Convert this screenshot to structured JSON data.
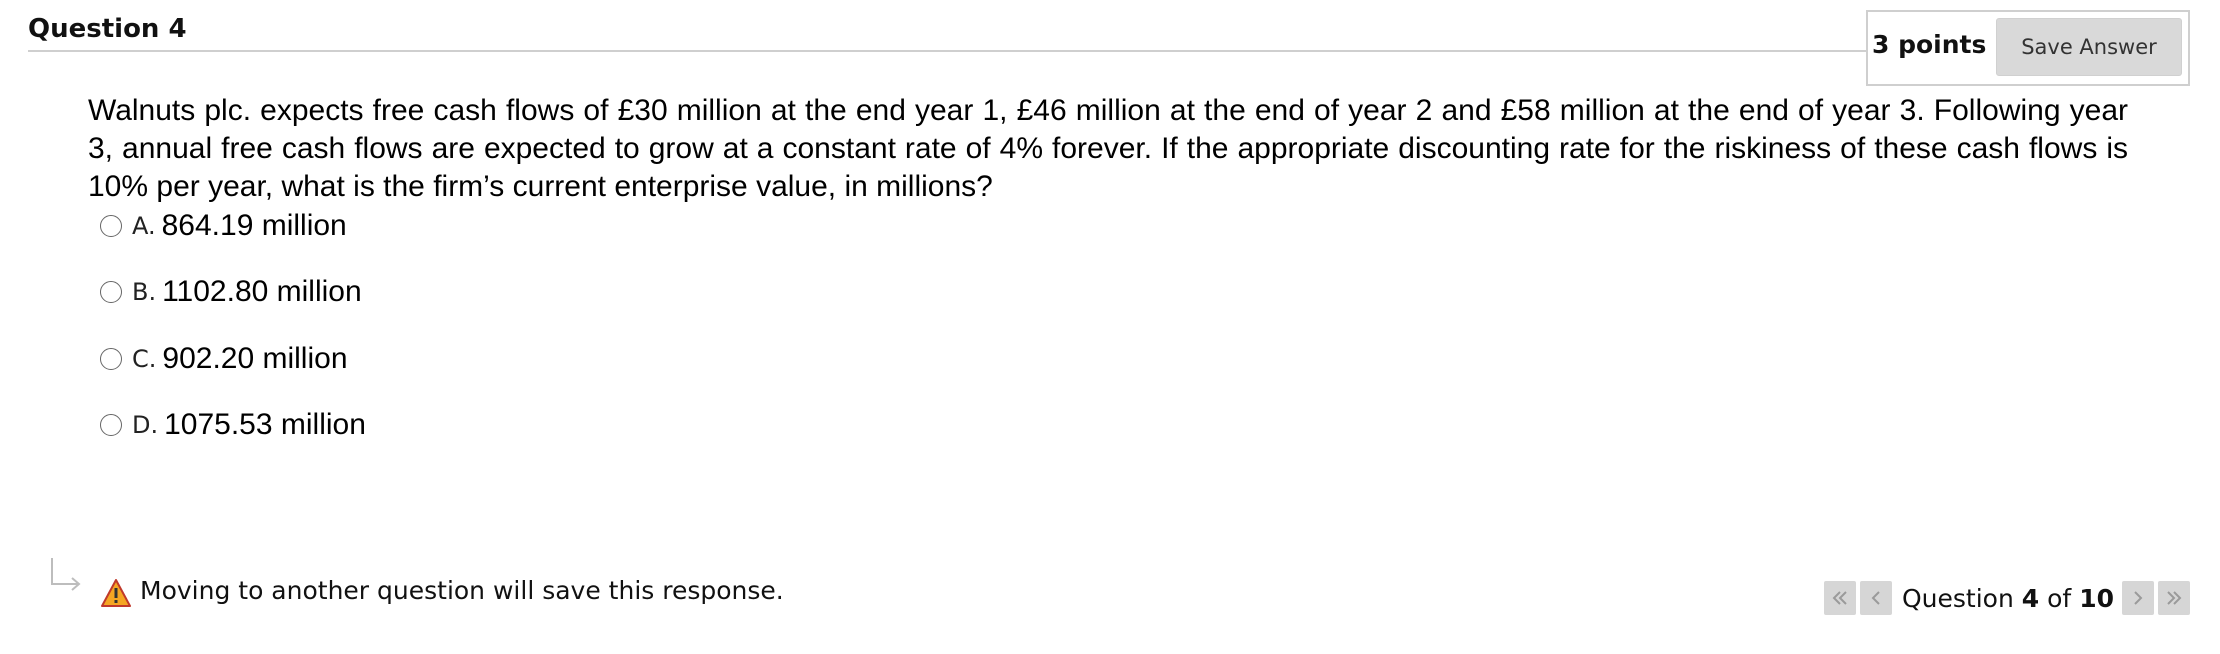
{
  "header": {
    "title": "Question 4",
    "points": "3 points",
    "save_label": "Save Answer"
  },
  "question": {
    "text": "Walnuts plc. expects free cash flows of £30 million at the end year 1, £46 million at the end of year 2 and £58 million at the end of year 3. Following year 3, annual free cash flows are expected to grow at a constant rate of 4% forever. If the appropriate discounting rate for the riskiness of these cash flows is 10% per year, what is the firm’s current enterprise value, in millions?"
  },
  "options": [
    {
      "letter": "A.",
      "text": "864.19 million",
      "selected": false
    },
    {
      "letter": "B.",
      "text": "1102.80 million",
      "selected": false
    },
    {
      "letter": "C.",
      "text": "902.20 million",
      "selected": false
    },
    {
      "letter": "D.",
      "text": "1075.53 million",
      "selected": false
    }
  ],
  "footer": {
    "warning": "Moving to another question will save this response.",
    "pager": {
      "prefix": "Question",
      "current": "4",
      "of": "of",
      "total": "10"
    }
  },
  "colors": {
    "warning_fill": "#f5a623",
    "button_bg": "#d9d9d9",
    "rule": "#cfcfcf"
  },
  "icons": [
    "return-arrow-icon",
    "warning-icon",
    "first-page-icon",
    "prev-page-icon",
    "next-page-icon",
    "last-page-icon"
  ]
}
